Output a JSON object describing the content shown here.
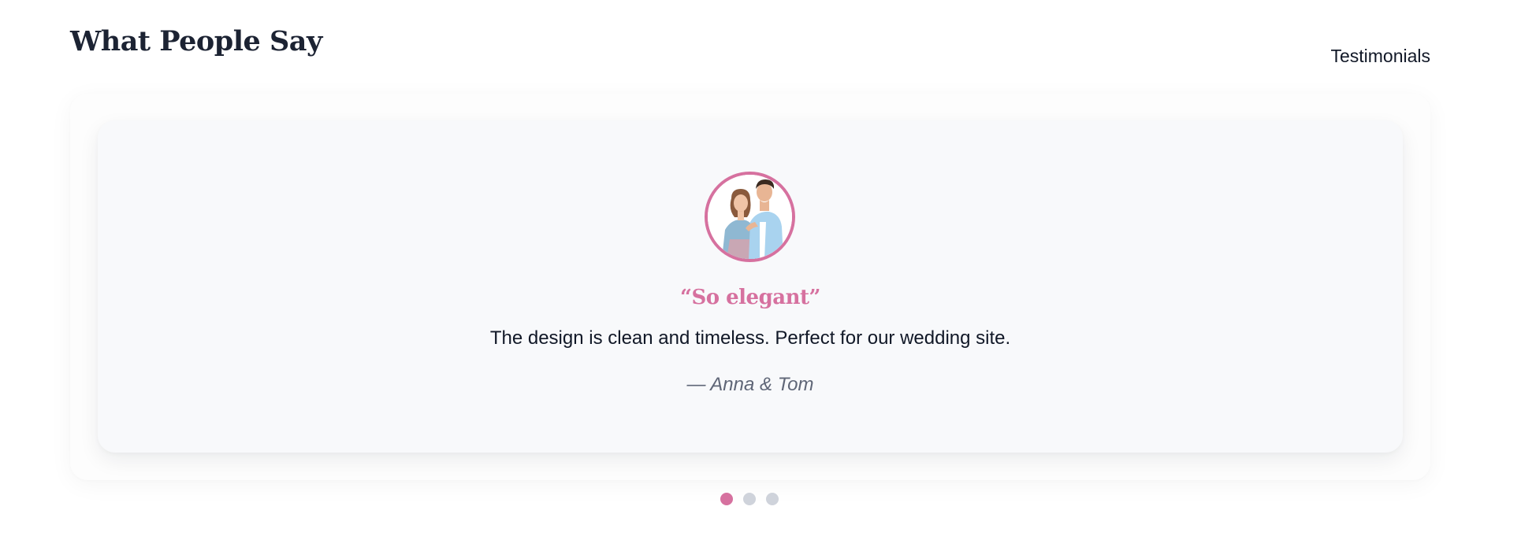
{
  "header": {
    "title": "What People Say",
    "section_label": "Testimonials"
  },
  "testimonial": {
    "avatar_icon": "couple-photo",
    "title": "“So elegant”",
    "body": "The design is clean and timeless. Perfect for our wedding site.",
    "author": "— Anna & Tom"
  },
  "pagination": {
    "count": 3,
    "active_index": 0
  },
  "colors": {
    "accent": "#d6719f",
    "heading": "#1c2333",
    "dot_inactive": "#cfd3db",
    "card_bg": "#f8f9fb"
  }
}
